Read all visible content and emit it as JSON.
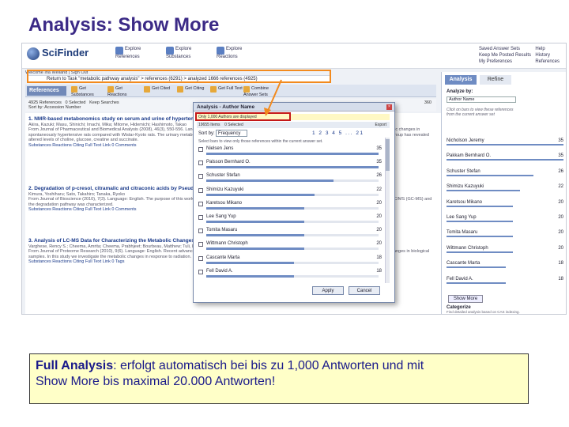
{
  "slide": {
    "title": "Analysis: Show More",
    "caption": {
      "label": "Full Analysis",
      "text1": ": erfolgt automatisch bei bis zu 1,000 Antworten und mit",
      "text2": "Show More bis maximal 20.000 Antworten!"
    }
  },
  "colors": {
    "title": "#3b2a86",
    "caption_bg": "#ffffc8",
    "highlight_orange": "#f28a1e",
    "highlight_red": "#c41818",
    "accent_blue": "#6f8cc3"
  },
  "app": {
    "logo": "SciFinder",
    "nav": [
      {
        "label1": "Explore",
        "label2": "References"
      },
      {
        "label1": "Explore",
        "label2": "Substances"
      },
      {
        "label1": "Explore",
        "label2": "Reactions"
      }
    ],
    "top_links_left": [
      "Saved Answer Sets",
      "Keep Me Posted Results",
      "My Preferences"
    ],
    "top_links_right": [
      "Help",
      "History",
      "References"
    ],
    "crumbs": [
      "Welcome Ina Weiland | Sign Out",
      "Create Keep Me Posted..."
    ],
    "task": "Return to Task \"metabolic pathway analysis\" > references (6291) > analyzed 1666 references (4925)",
    "toolbar": {
      "title": "References",
      "buttons": [
        "Get Substances",
        "Get Reactions",
        "Get Cited",
        "Get Citing",
        "Get Full Text",
        "Combine Answer Sets"
      ]
    },
    "results_bar": {
      "count": "4925 References",
      "selected": "0 Selected",
      "keep": "Keep Searches",
      "sort": "Sort by: Accession Number",
      "pages": "360"
    },
    "results": [
      {
        "num": "1.",
        "title": "NMR-based metabonomics study on serum and urine of hypertensive rats",
        "meta": "Akira, Kazuki; Masu, Shinichi; Imachi, Mika; Mitome, Hidemichi; Hashimoto, Takao",
        "body": "From Journal of Pharmaceutical and Biomedical Analysis (2008), 46(3), 550-556. Language: English. NMR-based metabonomic analysis was applied to study the rat serum and urine metabolic changes in spontaneously hypertensive rats compared with Wistar-Kyoto rats. The urinary metabolites were identified and selected metabolites were evaluated. The metabolic study in the hypertensive group has revealed altered levels of choline, glucose, creatine and succinate.",
        "links": "Substances  Reactions  Citing  Full Text  Link  0 Comments"
      },
      {
        "num": "2.",
        "title": "Degradation of p-cresol, citramalic and citraconic acids by Pseudomonas",
        "meta": "Kimura, Yoshiharu; Sato, Takahiro; Tanaka, Ryoko",
        "body": "From Journal of Bioscience (2010), 7(3). Language: English. The purpose of this work was to study the biodegradation pathway in Pseudomonas strains. The metabolites were identified by GC/MS (GC-MS) and the degradation pathway was characterized.",
        "links": "Substances  Reactions  Citing  Full Text  Link  0 Comments"
      },
      {
        "num": "3.",
        "title": "Analysis of LC-MS Data for Characterizing the Metabolic Changes",
        "meta": "Varghese, Rency S.; Cheema, Amrita; Cheema, Prabhjeet; Bourbeau, Matthew; Tuli, Leepika",
        "body": "From Journal of Proteome Research (2010), 9(6). Language: English. Recent advances in mass spectrometry-based metabolomics have enabled the comprehensive analysis of metabolic changes in biological samples. In this study we investigate the metabolic changes in response to radiation.",
        "links": "Substances  Reactions  Citing  Full Text  Link  0 Tags"
      }
    ],
    "panel": {
      "tab_active": "Analysis",
      "tab_other": "Refine",
      "analyze_label": "Analyze by:",
      "analyze_value": "Author Name",
      "note": "Click on bars to view these references from the current answer set",
      "rows": [
        {
          "name": "Nicholson Jeremy",
          "count": "35",
          "frac": 1.0
        },
        {
          "name": "Pakkam Bernhard O.",
          "count": "35",
          "frac": 1.0
        },
        {
          "name": "Schuster Stefan",
          "count": "26",
          "frac": 0.74
        },
        {
          "name": "Shimizu Kazuyuki",
          "count": "22",
          "frac": 0.63
        },
        {
          "name": "Karetsou Mikano",
          "count": "20",
          "frac": 0.57
        },
        {
          "name": "Lee Sang Yup",
          "count": "20",
          "frac": 0.57
        },
        {
          "name": "Tomita Masaru",
          "count": "20",
          "frac": 0.57
        },
        {
          "name": "Wittmann Christoph",
          "count": "20",
          "frac": 0.57
        },
        {
          "name": "Cascante Marta",
          "count": "18",
          "frac": 0.51
        },
        {
          "name": "Fell David A.",
          "count": "18",
          "frac": 0.51
        }
      ],
      "show_more": "Show More",
      "categorize": "Categorize",
      "footer": "Find detailed analysis based on CAS indexing."
    },
    "dialog": {
      "title": "Analysis - Author Name",
      "notice": "Only 1,000 Authors are displayed",
      "count": "19655 Items",
      "selected": "0 Selected",
      "export": "Export",
      "sort_label": "Sort by:",
      "sort_value": "Frequency",
      "pager": "1 2 3 4 5 ... 21",
      "instr": "Select bars to view only those references within the current answer set.",
      "rows": [
        {
          "name": "Nielsen Jens",
          "count": "35",
          "frac": 1.0
        },
        {
          "name": "Palsson Bernhard O.",
          "count": "35",
          "frac": 1.0
        },
        {
          "name": "Schuster Stefan",
          "count": "26",
          "frac": 0.74
        },
        {
          "name": "Shimizu Kazuyuki",
          "count": "22",
          "frac": 0.63
        },
        {
          "name": "Karetsou Mikano",
          "count": "20",
          "frac": 0.57
        },
        {
          "name": "Lee Sang Yup",
          "count": "20",
          "frac": 0.57
        },
        {
          "name": "Tomita Masaru",
          "count": "20",
          "frac": 0.57
        },
        {
          "name": "Wittmann Christoph",
          "count": "20",
          "frac": 0.57
        },
        {
          "name": "Cascante Marta",
          "count": "18",
          "frac": 0.51
        },
        {
          "name": "Fell David A.",
          "count": "18",
          "frac": 0.51
        }
      ],
      "apply": "Apply",
      "cancel": "Cancel"
    }
  }
}
